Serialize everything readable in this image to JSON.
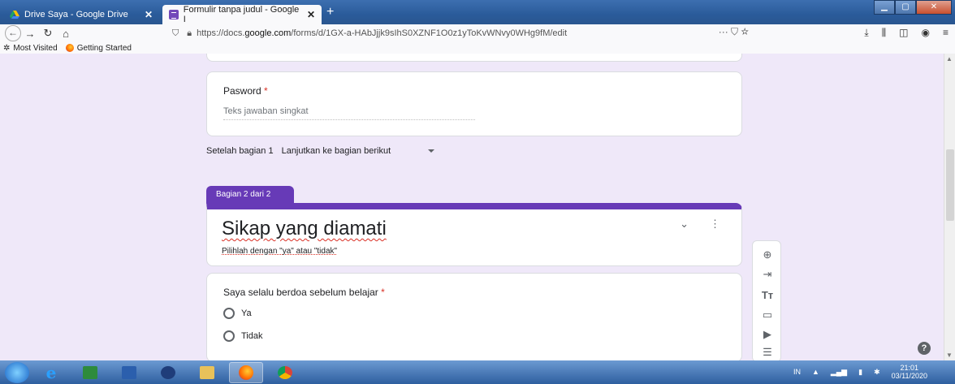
{
  "browser": {
    "tabs": [
      {
        "title": "Drive Saya - Google Drive",
        "close": "✕"
      },
      {
        "title": "Formulir tanpa judul - Google I",
        "close": "✕"
      }
    ],
    "new_tab": "+",
    "url_prefix": "https://docs.",
    "url_domain": "google.com",
    "url_path": "/forms/d/1GX-a-HAbJjjk9sIhS0XZNF1O0z1yToKvWNvy0WHg9fM/edit",
    "page_actions": "··· ⛉ ☆"
  },
  "bookmarks": [
    {
      "label": "Most Visited"
    },
    {
      "label": "Getting Started"
    }
  ],
  "form": {
    "question1": {
      "label": "Pasword",
      "required_mark": "*",
      "placeholder": "Teks jawaban singkat"
    },
    "after_section": {
      "label": "Setelah bagian 1",
      "value": "Lanjutkan ke bagian berikut"
    },
    "section_tag": "Bagian 2 dari 2",
    "section_title": "Sikap yang diamati",
    "section_desc": "Pilihlah dengan \"ya\" atau \"tidak\"",
    "question2": {
      "label": "Saya selalu berdoa sebelum belajar",
      "required_mark": "*",
      "options": [
        "Ya",
        "Tidak"
      ]
    }
  },
  "help": "?",
  "system": {
    "lang": "IN",
    "time": "21:01",
    "date": "03/11/2020"
  },
  "colors": {
    "accent": "#673ab7",
    "required": "#d93025",
    "background": "#efe8f9"
  }
}
